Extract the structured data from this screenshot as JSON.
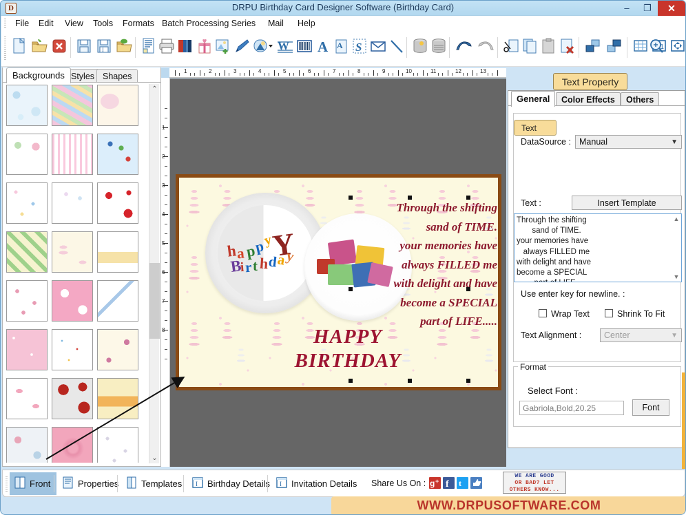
{
  "window": {
    "title": "DRPU Birthday Card Designer Software (Birthday Card)",
    "app_icon": "app-icon",
    "minimize": "–",
    "maximize": "❐",
    "close": "✕"
  },
  "menubar": {
    "items": [
      "File",
      "Edit",
      "View",
      "Tools",
      "Formats",
      "Batch Processing Series",
      "Mail",
      "Help"
    ]
  },
  "toolbar": {
    "icons": [
      "new-document-icon",
      "open-folder-icon",
      "close-document-icon",
      "save-icon",
      "save-as-icon",
      "export-icon",
      "page-setup-icon",
      "print-icon",
      "print-preview-icon",
      "gift-card-icon",
      "insert-image-icon",
      "pen-tool-icon",
      "shape-fill-icon",
      "watermark-icon",
      "barcode-icon",
      "text-icon",
      "text-box-icon",
      "signature-icon",
      "mail-icon",
      "line-tool-icon",
      "database-icon",
      "database-series-icon",
      "undo-icon",
      "redo-icon",
      "cut-icon",
      "copy-icon",
      "paste-icon",
      "delete-icon",
      "bring-to-front-icon",
      "send-to-back-icon",
      "grid-icon",
      "zoom-actual-icon",
      "fit-to-window-icon",
      "zoom-in-icon"
    ]
  },
  "left_panel": {
    "tabs": [
      {
        "label": "Backgrounds",
        "active": true
      },
      {
        "label": "Styles",
        "active": false
      },
      {
        "label": "Shapes",
        "active": false
      }
    ],
    "scroll_up": "⌃",
    "scroll_down": "⌄",
    "thumbnails": [
      {
        "name": "bubbles-blue",
        "colors": [
          "#eaf4fb",
          "#bcdcf0"
        ]
      },
      {
        "name": "pastel-brush",
        "colors": [
          "#f4d2e2",
          "#b8d9f2"
        ]
      },
      {
        "name": "soft-pink-wash",
        "colors": [
          "#fdf6e9",
          "#f6d7e1"
        ]
      },
      {
        "name": "happy-birthday-balloons",
        "colors": [
          "#ffffff",
          "#dff0d8"
        ]
      },
      {
        "name": "pink-hearts-stripes",
        "colors": [
          "#ffffff",
          "#f9c9dd"
        ]
      },
      {
        "name": "balloons-sky",
        "colors": [
          "#dceefb",
          "#ffffff"
        ]
      },
      {
        "name": "outline-hearts",
        "colors": [
          "#ffffff",
          "#f7c8dd"
        ]
      },
      {
        "name": "balloon-bunches",
        "colors": [
          "#ffffff",
          "#ecd9f0"
        ]
      },
      {
        "name": "red-hearts",
        "colors": [
          "#ffffff",
          "#d6232a"
        ]
      },
      {
        "name": "green-diagonal-stripes",
        "colors": [
          "#f6f3cf",
          "#9fd18b"
        ]
      },
      {
        "name": "pink-cakes",
        "colors": [
          "#fcf7e6",
          "#f5cdda"
        ]
      },
      {
        "name": "confetti-party",
        "colors": [
          "#ffffff",
          "#f6e2a8"
        ]
      },
      {
        "name": "rose-buds",
        "colors": [
          "#ffffff",
          "#e89cb4"
        ]
      },
      {
        "name": "pink-hearts-bold",
        "colors": [
          "#f4a8c4",
          "#ffffff"
        ]
      },
      {
        "name": "party-hats",
        "colors": [
          "#ffffff",
          "#a8c8e8"
        ]
      },
      {
        "name": "pink-texture",
        "colors": [
          "#f6c3d6",
          "#ffffff"
        ]
      },
      {
        "name": "confetti-dots",
        "colors": [
          "#ffffff",
          "#7fb8e0"
        ]
      },
      {
        "name": "cherry-blossom",
        "colors": [
          "#fdf8e8",
          "#cf7aa0"
        ]
      },
      {
        "name": "pink-cupcakes",
        "colors": [
          "#ffffff",
          "#f2a7bd"
        ]
      },
      {
        "name": "red-balloons",
        "colors": [
          "#ffffff",
          "#b8261f"
        ]
      },
      {
        "name": "birthday-cake-yellow",
        "colors": [
          "#f8eec2",
          "#f2b45a"
        ]
      },
      {
        "name": "pastel-hearts-blur",
        "colors": [
          "#e6eef5",
          "#e8a6b8"
        ]
      },
      {
        "name": "pink-roses",
        "colors": [
          "#f2a6bc",
          "#ffffff"
        ]
      },
      {
        "name": "grey-flowers",
        "colors": [
          "#ffffff",
          "#d8d4e4"
        ]
      }
    ]
  },
  "ruler": {
    "horizontal_labels": [
      "1",
      "2",
      "3",
      "4",
      "5",
      "6",
      "7",
      "8",
      "9",
      "10",
      "11",
      "12",
      "13"
    ],
    "vertical_labels": [
      "1",
      "2",
      "3",
      "4",
      "5",
      "6",
      "7",
      "8"
    ]
  },
  "card": {
    "border_color": "#8a4b14",
    "background_color": "#fcf9e0",
    "title_line1": "HAPPY",
    "title_line2": "BIRTHDAY",
    "title_color": "#9d1431",
    "art_word1": "happy",
    "art_word2": "Birthday",
    "verse_lines": [
      "Through the shifting",
      "sand of TIME.",
      "your memories have",
      "always FILLED me",
      "with delight and have",
      "become a SPECIAL",
      "part of LIFE....."
    ],
    "verse_color": "#8d1a2e"
  },
  "right_panel": {
    "badge": "Text Property",
    "tabs": [
      {
        "label": "General",
        "active": true
      },
      {
        "label": "Color Effects",
        "active": false
      },
      {
        "label": "Others",
        "active": false
      }
    ],
    "group_text_legend": "Text",
    "datasource_label": "DataSource :",
    "datasource_value": "Manual",
    "text_label": "Text :",
    "insert_template_label": "Insert Template",
    "textarea_value": "Through the shifting\n       sand of TIME.\nyour memories have\n   always FILLED me\nwith delight and have\nbecome a SPECIAL\n        part of LIFE.....",
    "newline_hint": "Use enter key for newline. :",
    "wrap_text_label": "Wrap Text",
    "wrap_text_checked": false,
    "shrink_to_fit_label": "Shrink To Fit",
    "shrink_to_fit_checked": false,
    "text_alignment_label": "Text Alignment :",
    "text_alignment_value": "Center",
    "format_legend": "Format",
    "select_font_label": "Select Font :",
    "font_value": "Gabriola,Bold,20.25",
    "font_button_label": "Font"
  },
  "statusbar": {
    "items": [
      {
        "label": "Front",
        "icon": "card-front-icon",
        "selected": true
      },
      {
        "label": "Properties",
        "icon": "properties-icon",
        "selected": false
      },
      {
        "label": "Templates",
        "icon": "templates-icon",
        "selected": false
      },
      {
        "label": "Birthday Details",
        "icon": "birthday-details-icon",
        "selected": false
      },
      {
        "label": "Invitation Details",
        "icon": "invitation-details-icon",
        "selected": false
      }
    ],
    "share_label": "Share Us On :",
    "social": [
      {
        "name": "google-plus-icon",
        "color": "#c9352b"
      },
      {
        "name": "facebook-icon",
        "color": "#3b5998"
      },
      {
        "name": "twitter-icon",
        "color": "#1da1f2"
      },
      {
        "name": "thumbs-up-icon",
        "color": "#4a7fc1"
      }
    ],
    "feedback_badge": [
      "WE ARE GOOD",
      "OR BAD? LET",
      "OTHERS KNOW..."
    ]
  },
  "footer": {
    "url": "WWW.DRPUSOFTWARE.COM"
  }
}
